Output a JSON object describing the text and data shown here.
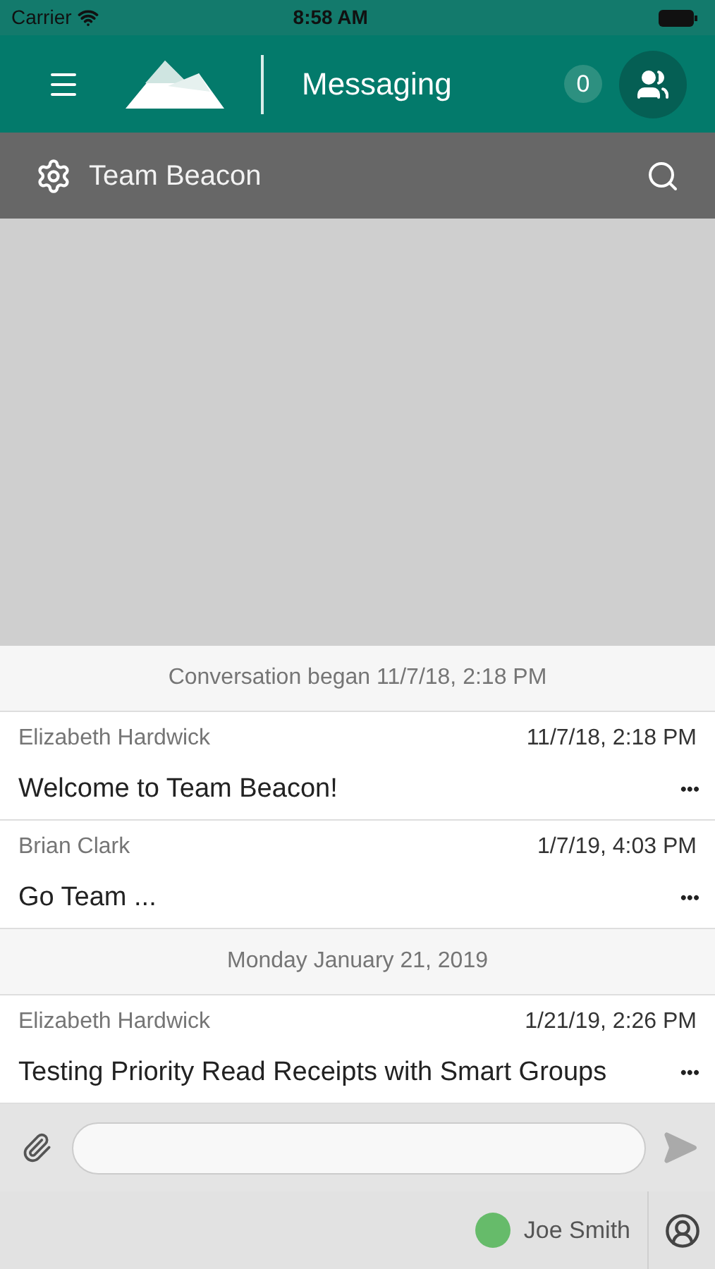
{
  "status_bar": {
    "carrier": "Carrier",
    "time": "8:58 AM"
  },
  "header": {
    "title": "Messaging",
    "count": "0"
  },
  "sub_bar": {
    "title": "Team Beacon"
  },
  "feed": [
    {
      "kind": "separator",
      "text": "Conversation began 11/7/18, 2:18 PM"
    },
    {
      "kind": "message",
      "sender": "Elizabeth Hardwick",
      "time": "11/7/18, 2:18 PM",
      "text": "Welcome to Team Beacon!",
      "more": "•••"
    },
    {
      "kind": "message",
      "sender": "Brian Clark",
      "time": "1/7/19, 4:03 PM",
      "text": "Go Team ...",
      "more": "•••"
    },
    {
      "kind": "separator",
      "text": "Monday January 21, 2019"
    },
    {
      "kind": "message",
      "sender": "Elizabeth Hardwick",
      "time": "1/21/19, 2:26 PM",
      "text": "Testing Priority Read Receipts with Smart Groups",
      "more": "•••"
    }
  ],
  "user": {
    "name": "Joe Smith",
    "color": "#66bb6a"
  }
}
